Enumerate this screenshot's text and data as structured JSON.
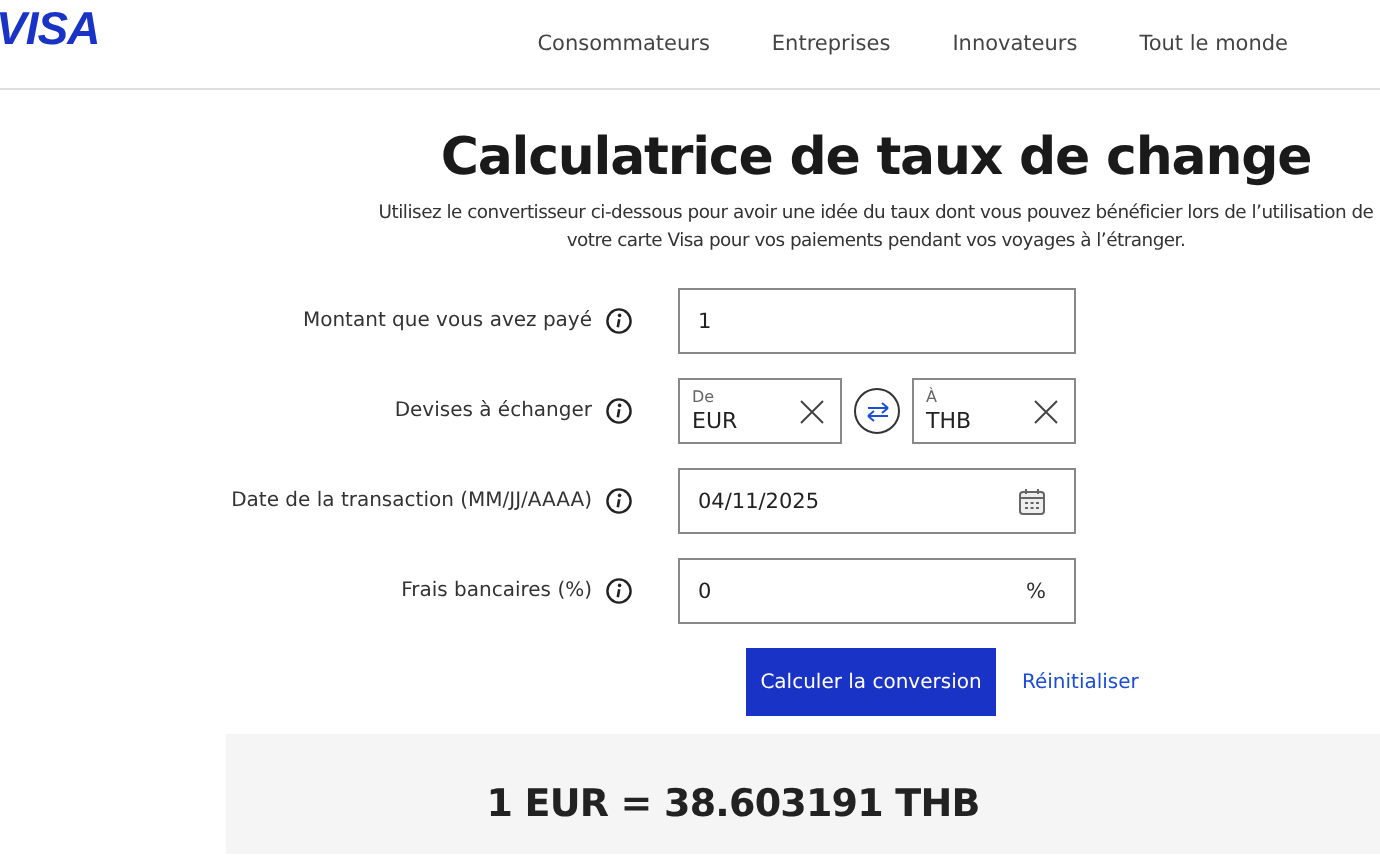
{
  "logo": "VISA",
  "nav": [
    "Consommateurs",
    "Entreprises",
    "Innovateurs",
    "Tout le monde"
  ],
  "title": "Calculatrice de taux de change",
  "subtitle": "Utilisez le convertisseur ci-dessous pour avoir une idée du taux dont vous pouvez bénéficier lors de l’utilisation de votre carte Visa pour vos paiements pendant vos voyages à l’étranger.",
  "fields": [
    {
      "kind": "text",
      "label": "Montant que vous avez payé",
      "value": "1"
    },
    {
      "kind": "currency",
      "label": "Devises à échanger",
      "from": {
        "caption": "De",
        "value": "EUR"
      },
      "to": {
        "caption": "À",
        "value": "THB"
      }
    },
    {
      "kind": "date",
      "label": "Date de la transaction (MM/JJ/AAAA)",
      "value": "04/11/2025"
    },
    {
      "kind": "percent",
      "label": "Frais bancaires (%)",
      "value": "0",
      "unit": "%"
    }
  ],
  "submit": "Calculer la conversion",
  "reset": "Réinitialiser",
  "result": "1 EUR = 38.603191 THB"
}
